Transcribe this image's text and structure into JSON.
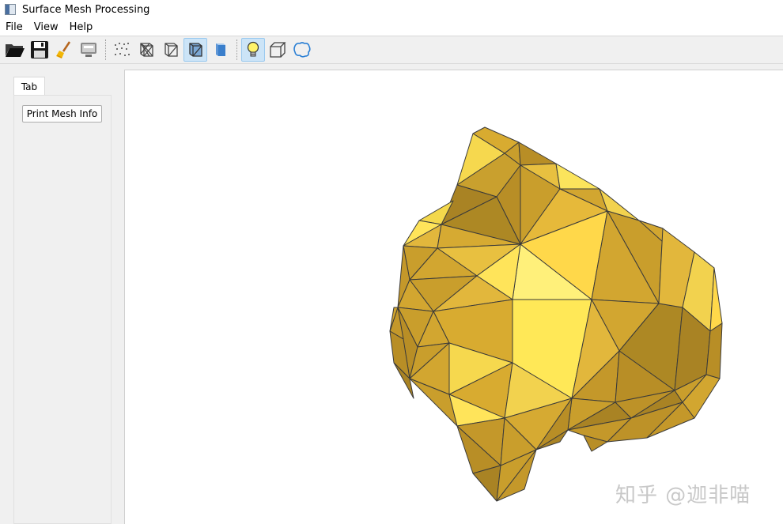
{
  "window": {
    "title": "Surface Mesh Processing"
  },
  "menu": {
    "items": [
      "File",
      "View",
      "Help"
    ]
  },
  "toolbar": {
    "buttons": [
      {
        "icon": "open-folder-icon"
      },
      {
        "icon": "save-icon"
      },
      {
        "icon": "clear-brush-icon"
      },
      {
        "icon": "screenshot-icon"
      },
      {
        "icon": "points-icon"
      },
      {
        "icon": "wireframe-icon"
      },
      {
        "icon": "hidden-line-icon"
      },
      {
        "icon": "flat-lines-icon",
        "checked": true
      },
      {
        "icon": "smooth-shading-icon"
      },
      {
        "icon": "lighting-icon",
        "checked": true
      },
      {
        "icon": "bounding-box-icon"
      },
      {
        "icon": "boundary-icon"
      }
    ]
  },
  "side_panel": {
    "tab_label": "Tab",
    "print_button": "Print Mesh Info"
  },
  "viewport": {
    "watermark": "知乎 @迦非喵",
    "mesh_colors": [
      "#d2a630",
      "#c99e2c",
      "#e2b73c",
      "#f2d24e",
      "#fbe45c",
      "#b88e26",
      "#a98324",
      "#ffd84a"
    ]
  }
}
